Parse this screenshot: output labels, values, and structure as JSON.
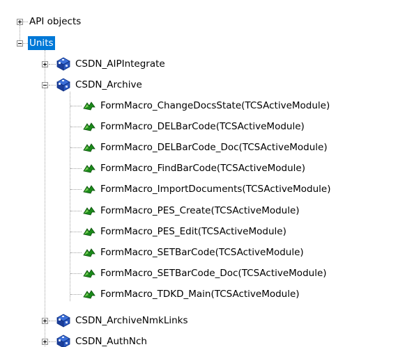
{
  "tree": {
    "api_objects": {
      "label": "API objects",
      "expanded": false
    },
    "units": {
      "label": "Units",
      "expanded": true,
      "selected": true,
      "children": [
        {
          "label": "CSDN_AIPIntegrate",
          "expanded": false,
          "icon": "unit-cube-icon"
        },
        {
          "label": "CSDN_Archive",
          "expanded": true,
          "icon": "unit-cube-icon",
          "children": [
            {
              "label": "FormMacro_ChangeDocsState(TCSActiveModule)",
              "icon": "macro-arrow-icon"
            },
            {
              "label": "FormMacro_DELBarCode(TCSActiveModule)",
              "icon": "macro-arrow-icon"
            },
            {
              "label": "FormMacro_DELBarCode_Doc(TCSActiveModule)",
              "icon": "macro-arrow-icon"
            },
            {
              "label": "FormMacro_FindBarCode(TCSActiveModule)",
              "icon": "macro-arrow-icon"
            },
            {
              "label": "FormMacro_ImportDocuments(TCSActiveModule)",
              "icon": "macro-arrow-icon"
            },
            {
              "label": "FormMacro_PES_Create(TCSActiveModule)",
              "icon": "macro-arrow-icon"
            },
            {
              "label": "FormMacro_PES_Edit(TCSActiveModule)",
              "icon": "macro-arrow-icon"
            },
            {
              "label": "FormMacro_SETBarCode(TCSActiveModule)",
              "icon": "macro-arrow-icon"
            },
            {
              "label": "FormMacro_SETBarCode_Doc(TCSActiveModule)",
              "icon": "macro-arrow-icon"
            },
            {
              "label": "FormMacro_TDKD_Main(TCSActiveModule)",
              "icon": "macro-arrow-icon"
            }
          ]
        },
        {
          "label": "CSDN_ArchiveNmkLinks",
          "expanded": false,
          "icon": "unit-cube-icon"
        },
        {
          "label": "CSDN_AuthNch",
          "expanded": false,
          "icon": "unit-cube-icon"
        }
      ]
    }
  },
  "colors": {
    "selection": "#0078d7",
    "tree_lines": "#a0a0a0",
    "macro_icon": "#1a8a1a",
    "cube_icon": "#1d4fb8"
  }
}
